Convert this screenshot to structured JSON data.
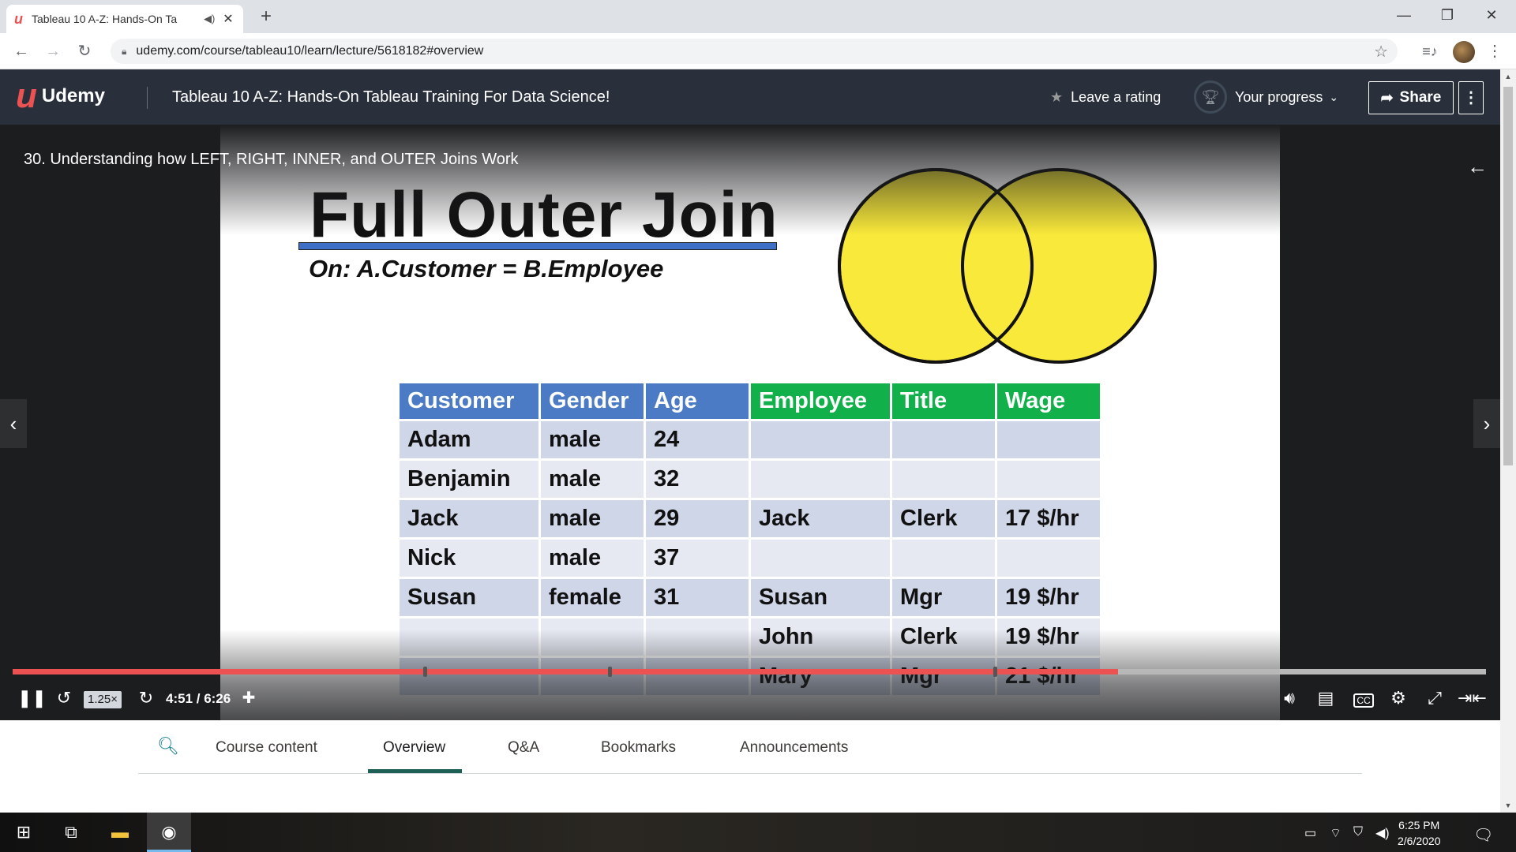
{
  "browser": {
    "tab_title": "Tableau 10 A-Z: Hands-On Ta",
    "url": "udemy.com/course/tableau10/learn/lecture/5618182#overview"
  },
  "header": {
    "logo_text": "Udemy",
    "course_title": "Tableau 10 A-Z: Hands-On Tableau Training For Data Science!",
    "rating_label": "Leave a rating",
    "progress_label": "Your progress",
    "share_label": "Share"
  },
  "video": {
    "lecture_title": "30. Understanding how LEFT, RIGHT, INNER, and OUTER Joins Work",
    "slide": {
      "title": "Full Outer Join",
      "subtitle": "On: A.Customer = B.Employee",
      "headers": [
        "Customer",
        "Gender",
        "Age",
        "Employee",
        "Title",
        "Wage"
      ],
      "header_colors": [
        "blue",
        "blue",
        "blue",
        "green",
        "green",
        "green"
      ],
      "rows": [
        [
          "Adam",
          "male",
          "24",
          "",
          "",
          ""
        ],
        [
          "Benjamin",
          "male",
          "32",
          "",
          "",
          ""
        ],
        [
          "Jack",
          "male",
          "29",
          "Jack",
          "Clerk",
          "17 $/hr"
        ],
        [
          "Nick",
          "male",
          "37",
          "",
          "",
          ""
        ],
        [
          "Susan",
          "female",
          "31",
          "Susan",
          "Mgr",
          "19 $/hr"
        ],
        [
          "",
          "",
          "",
          "John",
          "Clerk",
          "19 $/hr"
        ],
        [
          "",
          "",
          "",
          "Mary",
          "Mgr",
          "21 $/hr"
        ]
      ],
      "venn_color": "#f9e93a"
    },
    "player": {
      "speed": "1.25×",
      "time": "4:51 / 6:26",
      "progress": 0.75,
      "accent": "#ec5252"
    }
  },
  "below_tabs": {
    "items": [
      "Course content",
      "Overview",
      "Q&A",
      "Bookmarks",
      "Announcements"
    ],
    "active": "Overview"
  },
  "taskbar": {
    "time": "6:25 PM",
    "date": "2/6/2020"
  }
}
